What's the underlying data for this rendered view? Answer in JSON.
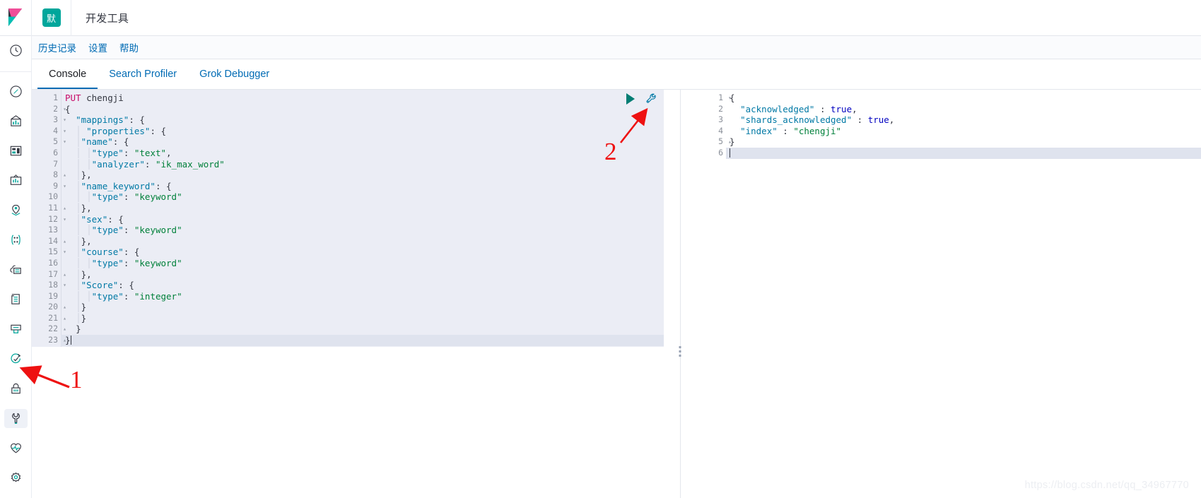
{
  "header": {
    "logo_name": "kibana-logo",
    "space_badge": "默",
    "app_title": "开发工具"
  },
  "nav_rail": {
    "items": [
      {
        "name": "recently-viewed-icon",
        "label": "Recently viewed"
      },
      {
        "name": "discover-icon",
        "label": "Discover"
      },
      {
        "name": "visualize-icon",
        "label": "Visualize"
      },
      {
        "name": "dashboard-icon",
        "label": "Dashboard"
      },
      {
        "name": "canvas-icon",
        "label": "Canvas"
      },
      {
        "name": "maps-icon",
        "label": "Maps"
      },
      {
        "name": "machine-learning-icon",
        "label": "Machine Learning"
      },
      {
        "name": "infrastructure-icon",
        "label": "Infrastructure"
      },
      {
        "name": "logs-icon",
        "label": "Logs"
      },
      {
        "name": "apm-icon",
        "label": "APM"
      },
      {
        "name": "uptime-icon",
        "label": "Uptime"
      },
      {
        "name": "siem-icon",
        "label": "SIEM"
      },
      {
        "name": "dev-tools-icon",
        "label": "Dev Tools",
        "active": true
      },
      {
        "name": "monitoring-icon",
        "label": "Monitoring"
      },
      {
        "name": "management-icon",
        "label": "Management"
      }
    ]
  },
  "menubar": {
    "items": [
      {
        "name": "history",
        "label": "历史记录"
      },
      {
        "name": "settings",
        "label": "设置"
      },
      {
        "name": "help",
        "label": "帮助"
      }
    ]
  },
  "tabs": [
    {
      "name": "console",
      "label": "Console",
      "active": true
    },
    {
      "name": "search-profiler",
      "label": "Search Profiler",
      "active": false
    },
    {
      "name": "grok-debugger",
      "label": "Grok Debugger",
      "active": false
    }
  ],
  "editor": {
    "toolbar": {
      "play_label": "play-button",
      "wrench_label": "wrench-button"
    },
    "active_line": 23,
    "lines": [
      {
        "n": "1",
        "fold": "",
        "text": "PUT chengji"
      },
      {
        "n": "2",
        "fold": "▾",
        "text": "{"
      },
      {
        "n": "3",
        "fold": "▾",
        "text": "  \"mappings\": {"
      },
      {
        "n": "4",
        "fold": "▾",
        "text": "    \"properties\": {"
      },
      {
        "n": "5",
        "fold": "▾",
        "text": "   \"name\": {"
      },
      {
        "n": "6",
        "fold": "",
        "text": "     \"type\": \"text\","
      },
      {
        "n": "7",
        "fold": "",
        "text": "     \"analyzer\": \"ik_max_word\""
      },
      {
        "n": "8",
        "fold": "▴",
        "text": "   },"
      },
      {
        "n": "9",
        "fold": "▾",
        "text": "   \"name_keyword\": {"
      },
      {
        "n": "10",
        "fold": "",
        "text": "     \"type\": \"keyword\""
      },
      {
        "n": "11",
        "fold": "▴",
        "text": "   },"
      },
      {
        "n": "12",
        "fold": "▾",
        "text": "   \"sex\": {"
      },
      {
        "n": "13",
        "fold": "",
        "text": "     \"type\": \"keyword\""
      },
      {
        "n": "14",
        "fold": "▴",
        "text": "   },"
      },
      {
        "n": "15",
        "fold": "▾",
        "text": "   \"course\": {"
      },
      {
        "n": "16",
        "fold": "",
        "text": "     \"type\": \"keyword\""
      },
      {
        "n": "17",
        "fold": "▴",
        "text": "   },"
      },
      {
        "n": "18",
        "fold": "▾",
        "text": "   \"Score\": {"
      },
      {
        "n": "19",
        "fold": "",
        "text": "     \"type\": \"integer\""
      },
      {
        "n": "20",
        "fold": "▴",
        "text": "   }"
      },
      {
        "n": "21",
        "fold": "▴",
        "text": "   }"
      },
      {
        "n": "22",
        "fold": "▴",
        "text": "  }"
      },
      {
        "n": "23",
        "fold": "▴",
        "text": "}"
      }
    ]
  },
  "response": {
    "active_line": 6,
    "lines": [
      {
        "n": "1",
        "fold": "▾",
        "text": "{"
      },
      {
        "n": "2",
        "fold": "",
        "text": "  \"acknowledged\" : true,"
      },
      {
        "n": "3",
        "fold": "",
        "text": "  \"shards_acknowledged\" : true,"
      },
      {
        "n": "4",
        "fold": "",
        "text": "  \"index\" : \"chengji\""
      },
      {
        "n": "5",
        "fold": "▴",
        "text": "}"
      },
      {
        "n": "6",
        "fold": "",
        "text": ""
      }
    ]
  },
  "annotations": [
    {
      "name": "annotation-1",
      "label": "1"
    },
    {
      "name": "annotation-2",
      "label": "2"
    }
  ],
  "watermark": "https://blog.csdn.net/qq_34967770",
  "colors": {
    "accent": "#006bb4",
    "space_badge_bg": "#00A69B",
    "play": "#017d73",
    "annotation_red": "#ee1111",
    "editor_bg": "#ebedf5"
  }
}
